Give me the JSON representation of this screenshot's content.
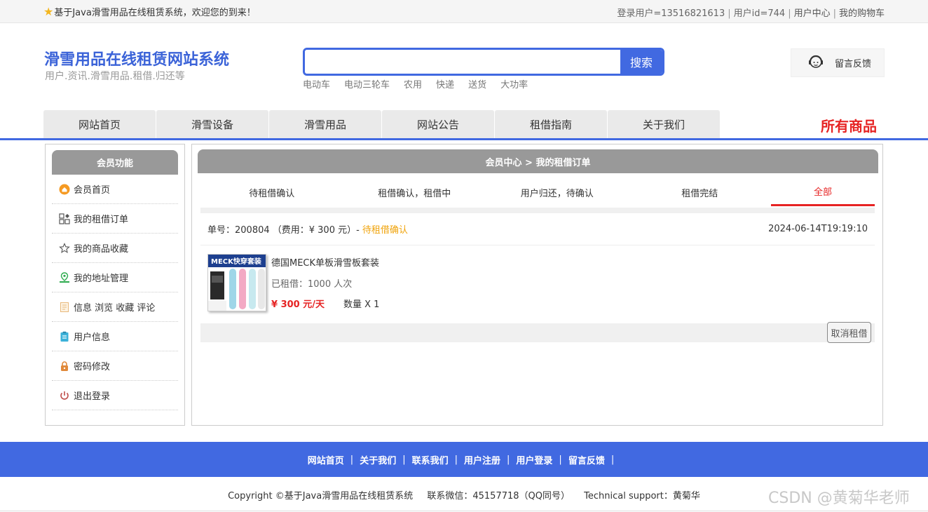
{
  "topbar": {
    "welcome": "基于Java滑雪用品在线租赁系统，欢迎您的到来！",
    "login_user": "登录用户=13516821613",
    "user_id": "用户id=744",
    "user_center": "用户中心",
    "cart": "我的购物车"
  },
  "header": {
    "title": "滑雪用品在线租赁网站系统",
    "subtitle": "用户.资讯.滑雪用品.租借.归还等",
    "search_button": "搜索",
    "search_value": "",
    "hot_words": [
      "电动车",
      "电动三轮车",
      "农用",
      "快递",
      "送货",
      "大功率"
    ],
    "feedback": "留言反馈"
  },
  "nav": {
    "items": [
      "网站首页",
      "滑雪设备",
      "滑雪用品",
      "网站公告",
      "租借指南",
      "关于我们"
    ],
    "all_goods": "所有商品"
  },
  "sidebar": {
    "title": "会员功能",
    "items": [
      {
        "label": "会员首页",
        "icon": "home-icon"
      },
      {
        "label": "我的租借订单",
        "icon": "order-grid-icon"
      },
      {
        "label": "我的商品收藏",
        "icon": "star-icon"
      },
      {
        "label": "我的地址管理",
        "icon": "location-icon"
      },
      {
        "label": "信息 浏览 收藏 评论",
        "icon": "document-icon"
      },
      {
        "label": "用户信息",
        "icon": "clipboard-icon"
      },
      {
        "label": "密码修改",
        "icon": "lock-icon"
      },
      {
        "label": "退出登录",
        "icon": "power-icon"
      }
    ]
  },
  "main": {
    "breadcrumb": "会员中心 > 我的租借订单",
    "tabs": [
      "待租借确认",
      "租借确认，租借中",
      "用户归还，待确认",
      "租借完结",
      "全部"
    ],
    "active_tab": "全部",
    "order": {
      "number_text": "单号：200804 （费用：¥ 300 元）-",
      "status": "待租借确认",
      "time": "2024-06-14T19:19:10",
      "product_name": "德国MECK单板滑雪板套装",
      "rent_count": "已租借：1000 人次",
      "price": "¥ 300 元/天",
      "quantity": "数量 X 1",
      "thumb_caption": "MECK快穿套装",
      "cancel": "取消租借"
    }
  },
  "footer": {
    "links": [
      "网站首页",
      "关于我们",
      "联系我们",
      "用户注册",
      "用户登录",
      "留言反馈"
    ],
    "copyright": "Copyright ©基于Java滑雪用品在线租赁系统",
    "contact": "联系微信：45157718（QQ同号）",
    "support": "Technical support：黄菊华",
    "watermark": "CSDN @黄菊华老师"
  },
  "colors": {
    "accent": "#4169e1",
    "danger": "#e62323",
    "status": "#f0a30a"
  }
}
